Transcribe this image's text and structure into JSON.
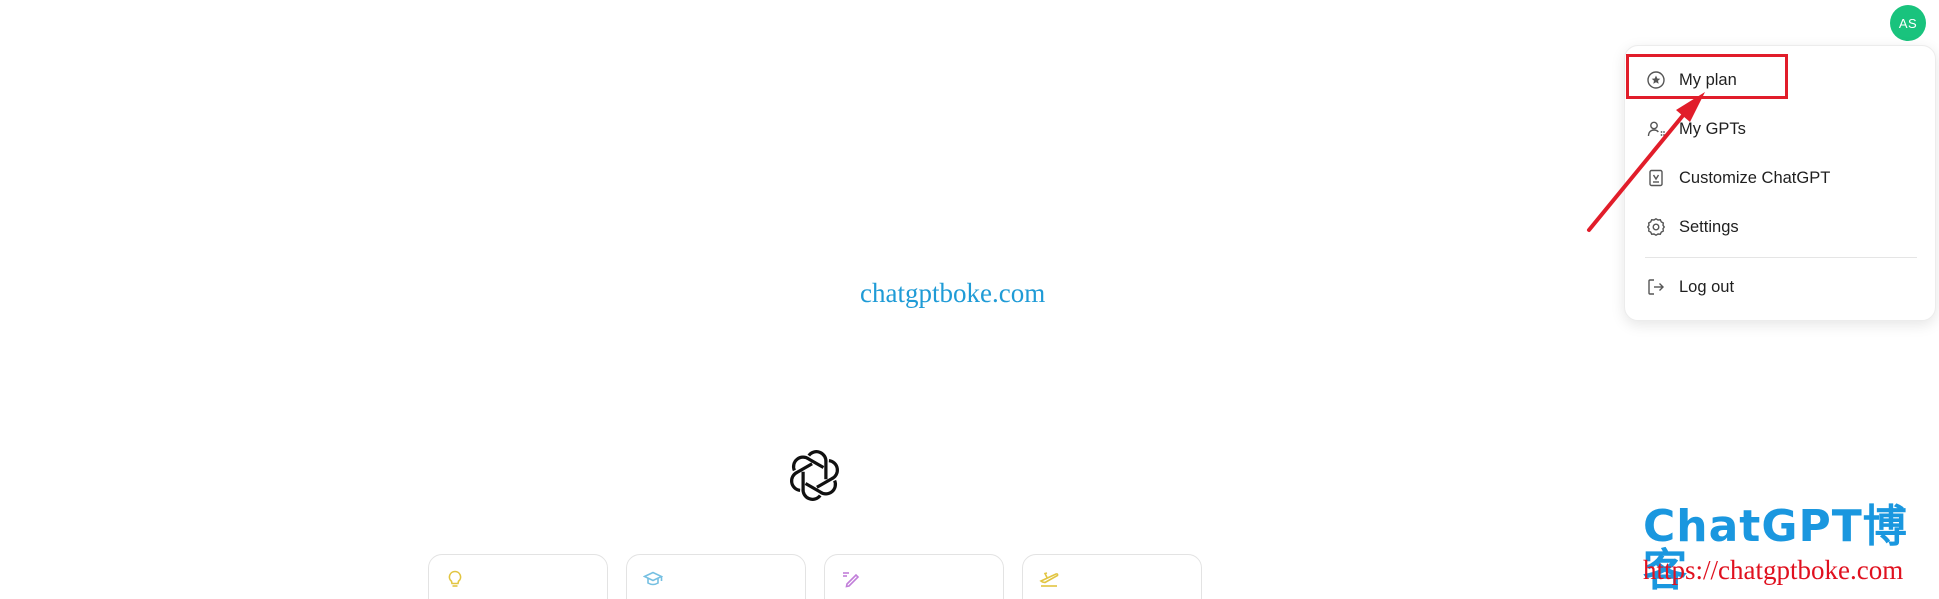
{
  "header": {
    "avatar_initials": "AS",
    "avatar_color": "#19c37d"
  },
  "menu": {
    "items": [
      {
        "label": "My plan",
        "icon": "plan-badge-icon"
      },
      {
        "label": "My GPTs",
        "icon": "user-group-icon"
      },
      {
        "label": "Customize ChatGPT",
        "icon": "customize-icon"
      },
      {
        "label": "Settings",
        "icon": "gear-icon"
      },
      {
        "label": "Log out",
        "icon": "logout-icon"
      }
    ],
    "highlight_color": "#e11d2a"
  },
  "watermark": {
    "center_text": "chatgptboke.com",
    "brand_text": "ChatGPT博客",
    "url_text": "https://chatgptboke.com",
    "brand_color": "#1a97df",
    "url_color": "#e0111f"
  },
  "main": {
    "logo_icon": "openai-logo-icon",
    "cards": [
      {
        "icon": "lightbulb-icon",
        "color": "#e2c541"
      },
      {
        "icon": "graduation-cap-icon",
        "color": "#76c0e2"
      },
      {
        "icon": "pen-icon",
        "color": "#c17ed9"
      },
      {
        "icon": "airplane-icon",
        "color": "#e2c541"
      }
    ]
  }
}
